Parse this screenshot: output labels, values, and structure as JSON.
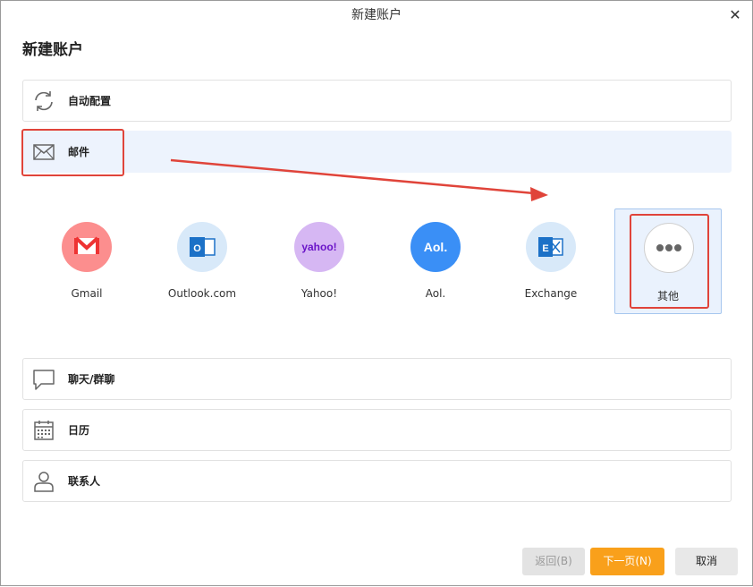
{
  "window": {
    "title": "新建账户",
    "close_glyph": "✕"
  },
  "heading": "新建账户",
  "rows": {
    "auto_config": {
      "label": "自动配置",
      "icon": "refresh-icon"
    },
    "email": {
      "label": "邮件",
      "icon": "envelope-icon"
    },
    "chat": {
      "label": "聊天/群聊",
      "icon": "chat-bubble-icon"
    },
    "calendar": {
      "label": "日历",
      "icon": "calendar-icon"
    },
    "contacts": {
      "label": "联系人",
      "icon": "person-icon"
    }
  },
  "providers": [
    {
      "label": "Gmail",
      "icon": "gmail-icon",
      "color": "#fc8e8e"
    },
    {
      "label": "Outlook.com",
      "icon": "outlook-icon",
      "color": "#d8e9f9",
      "badge": "O"
    },
    {
      "label": "Yahoo!",
      "icon": "yahoo-icon",
      "color": "#d6b7f3",
      "badge": "yahoo!"
    },
    {
      "label": "Aol.",
      "icon": "aol-icon",
      "color": "#3a8ff6",
      "badge": "Aol."
    },
    {
      "label": "Exchange",
      "icon": "exchange-icon",
      "color": "#d8e9f9",
      "badge": "E"
    },
    {
      "label": "其他",
      "icon": "more-dots-icon",
      "color": "#ffffff",
      "selected": true
    }
  ],
  "buttons": {
    "back": "返回(B)",
    "next": "下一页(N)",
    "cancel": "取消"
  },
  "colors": {
    "accent": "#f9a01b",
    "selected_row": "#edf3fd",
    "annotation": "#e0443a"
  }
}
